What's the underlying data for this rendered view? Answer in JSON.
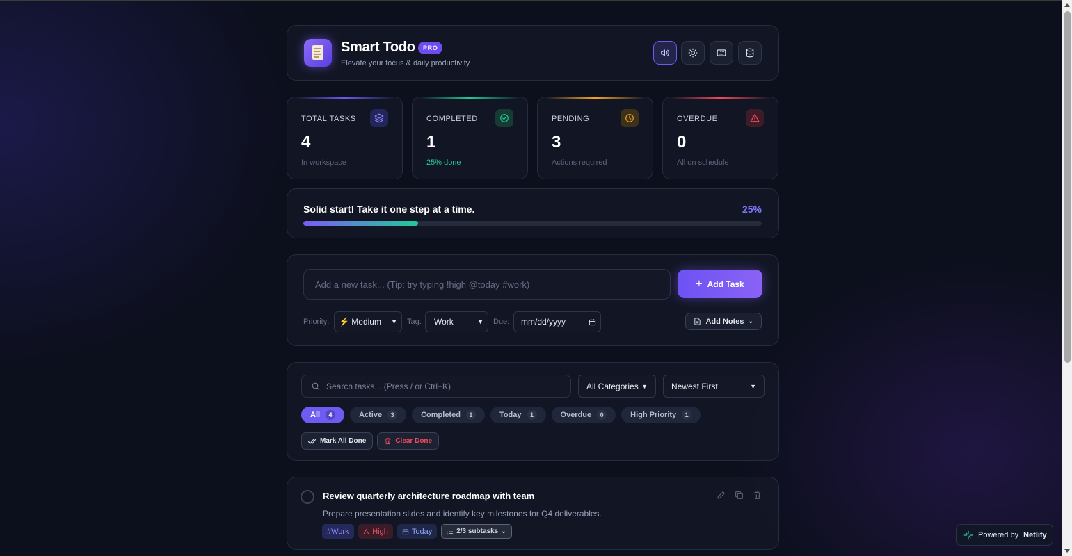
{
  "header": {
    "title": "Smart Todo",
    "badge": "PRO",
    "subtitle": "Elevate your focus & daily productivity",
    "buttons": [
      "sound-icon",
      "theme-icon",
      "keyboard-icon",
      "database-icon"
    ]
  },
  "stats": [
    {
      "label": "TOTAL TASKS",
      "value": "4",
      "sub": "In workspace",
      "color": "#6b5cf0",
      "icon": "layers-icon"
    },
    {
      "label": "COMPLETED",
      "value": "1",
      "sub": "25% done",
      "color": "#22c996",
      "icon": "check-circle-icon"
    },
    {
      "label": "PENDING",
      "value": "3",
      "sub": "Actions required",
      "color": "#f5a524",
      "icon": "clock-icon"
    },
    {
      "label": "OVERDUE",
      "value": "0",
      "sub": "All on schedule",
      "color": "#ef4a5f",
      "icon": "alert-triangle-icon"
    }
  ],
  "progress": {
    "message": "Solid start! Take it one step at a time.",
    "percent_label": "25%",
    "fraction": 0.25
  },
  "add_task": {
    "placeholder": "Add a new task... (Tip: try typing !high @today #work)",
    "button_label": "Add Task",
    "priority_label": "Priority:",
    "priority_value": "⚡ Medium",
    "tag_label": "Tag:",
    "tag_value": "Work",
    "due_label": "Due:",
    "due_value": "mm/dd/yyyy",
    "notes_label": "Add Notes"
  },
  "filters": {
    "search_placeholder": "Search tasks... (Press / or Ctrl+K)",
    "category_value": "All Categories",
    "sort_value": "Newest First",
    "chips": [
      {
        "label": "All",
        "count": "4"
      },
      {
        "label": "Active",
        "count": "3"
      },
      {
        "label": "Completed",
        "count": "1"
      },
      {
        "label": "Today",
        "count": "1"
      },
      {
        "label": "Overdue",
        "count": "0"
      },
      {
        "label": "High Priority",
        "count": "1"
      }
    ],
    "mark_all_done": "Mark All Done",
    "clear_done": "Clear Done"
  },
  "tasks": [
    {
      "title": "Review quarterly architecture roadmap with team",
      "description": "Prepare presentation slides and identify key milestones for Q4 deliverables.",
      "tag": "#Work",
      "priority": "High",
      "due": "Today",
      "subtasks": "2/3 subtasks"
    }
  ],
  "footer": {
    "powered_prefix": "Powered by",
    "powered_brand": "Netlify"
  },
  "colors": {
    "accent": "#6c5cf2",
    "success": "#22c996",
    "warning": "#f5a524",
    "danger": "#ef4a5f"
  }
}
